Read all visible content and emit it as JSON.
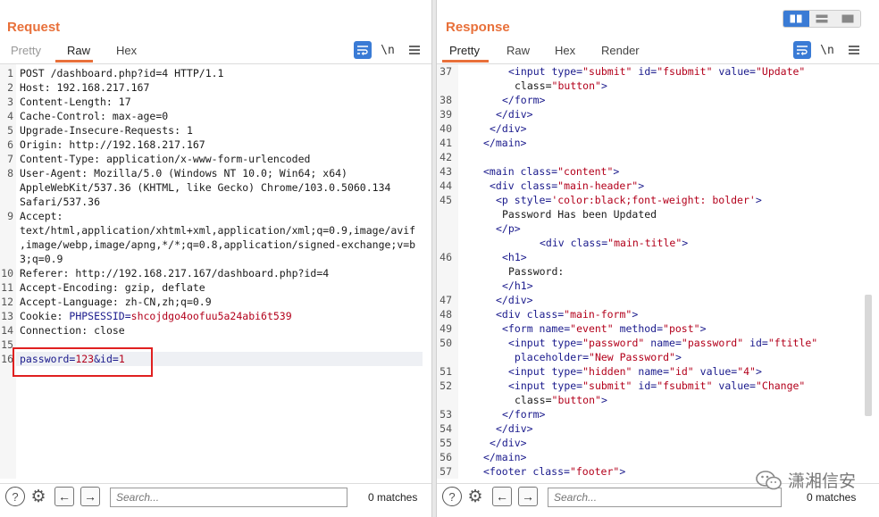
{
  "request": {
    "title": "Request",
    "tabs": [
      "Pretty",
      "Raw",
      "Hex"
    ],
    "active_tab": "Raw",
    "icons": [
      "wrap-icon",
      "newline-icon",
      "menu-icon"
    ],
    "newline_label": "\\n",
    "lines": [
      {
        "n": "1",
        "text": "POST /dashboard.php?id=4 HTTP/1.1"
      },
      {
        "n": "2",
        "text": "Host: 192.168.217.167"
      },
      {
        "n": "3",
        "text": "Content-Length: 17"
      },
      {
        "n": "4",
        "text": "Cache-Control: max-age=0"
      },
      {
        "n": "5",
        "text": "Upgrade-Insecure-Requests: 1"
      },
      {
        "n": "6",
        "text": "Origin: http://192.168.217.167"
      },
      {
        "n": "7",
        "text": "Content-Type: application/x-www-form-urlencoded"
      },
      {
        "n": "8",
        "text": "User-Agent: Mozilla/5.0 (Windows NT 10.0; Win64; x64)"
      },
      {
        "n": "",
        "text": "AppleWebKit/537.36 (KHTML, like Gecko) Chrome/103.0.5060.134"
      },
      {
        "n": "",
        "text": "Safari/537.36"
      },
      {
        "n": "9",
        "text": "Accept:"
      },
      {
        "n": "",
        "text": "text/html,application/xhtml+xml,application/xml;q=0.9,image/avif"
      },
      {
        "n": "",
        "text": ",image/webp,image/apng,*/*;q=0.8,application/signed-exchange;v=b"
      },
      {
        "n": "",
        "text": "3;q=0.9"
      },
      {
        "n": "10",
        "text": "Referer: http://192.168.217.167/dashboard.php?id=4"
      },
      {
        "n": "11",
        "text": "Accept-Encoding: gzip, deflate"
      },
      {
        "n": "12",
        "text": "Accept-Language: zh-CN,zh;q=0.9"
      },
      {
        "n": "13",
        "text": "Cookie: PHPSESSID=shcojdgo4oofuu5a24abi6t539"
      },
      {
        "n": "14",
        "text": "Connection: close"
      },
      {
        "n": "15",
        "text": ""
      },
      {
        "n": "16",
        "text": "password=123&id=1"
      }
    ],
    "search_placeholder": "Search...",
    "matches": "0 matches"
  },
  "response": {
    "title": "Response",
    "tabs": [
      "Pretty",
      "Raw",
      "Hex",
      "Render"
    ],
    "active_tab": "Pretty",
    "icons": [
      "wrap-icon",
      "newline-icon",
      "menu-icon"
    ],
    "newline_label": "\\n",
    "lines": [
      {
        "n": "37",
        "indent": 6,
        "text": "<input type=\"submit\" id=\"fsubmit\" value=\"Update\""
      },
      {
        "n": "",
        "indent": 7,
        "text": "class=\"button\">"
      },
      {
        "n": "38",
        "indent": 5,
        "text": "</form>"
      },
      {
        "n": "39",
        "indent": 4,
        "text": "</div>"
      },
      {
        "n": "40",
        "indent": 3,
        "text": "</div>"
      },
      {
        "n": "41",
        "indent": 2,
        "text": "</main>"
      },
      {
        "n": "42",
        "indent": 0,
        "text": ""
      },
      {
        "n": "43",
        "indent": 2,
        "text": "<main class=\"content\">"
      },
      {
        "n": "44",
        "indent": 3,
        "text": "<div class=\"main-header\">"
      },
      {
        "n": "45",
        "indent": 4,
        "text": "<p style='color:black;font-weight: bolder'>"
      },
      {
        "n": "",
        "indent": 5,
        "text": "Password Has been Updated"
      },
      {
        "n": "",
        "indent": 4,
        "text": "</p>"
      },
      {
        "n": "",
        "indent": 11,
        "text": "<div class=\"main-title\">"
      },
      {
        "n": "46",
        "indent": 5,
        "text": "<h1>"
      },
      {
        "n": "",
        "indent": 6,
        "text": "Password:"
      },
      {
        "n": "",
        "indent": 5,
        "text": "</h1>"
      },
      {
        "n": "47",
        "indent": 4,
        "text": "</div>"
      },
      {
        "n": "48",
        "indent": 4,
        "text": "<div class=\"main-form\">"
      },
      {
        "n": "49",
        "indent": 5,
        "text": "<form name=\"event\" method=\"post\">"
      },
      {
        "n": "50",
        "indent": 6,
        "text": "<input type=\"password\" name=\"password\" id=\"ftitle\""
      },
      {
        "n": "",
        "indent": 6,
        "text": " placeholder=\"New Password\">"
      },
      {
        "n": "51",
        "indent": 6,
        "text": "<input type=\"hidden\" name=\"id\" value=\"4\">"
      },
      {
        "n": "52",
        "indent": 6,
        "text": "<input type=\"submit\" id=\"fsubmit\" value=\"Change\""
      },
      {
        "n": "",
        "indent": 7,
        "text": "class=\"button\">"
      },
      {
        "n": "53",
        "indent": 5,
        "text": "</form>"
      },
      {
        "n": "54",
        "indent": 4,
        "text": "</div>"
      },
      {
        "n": "55",
        "indent": 3,
        "text": "</div>"
      },
      {
        "n": "56",
        "indent": 2,
        "text": "</main>"
      },
      {
        "n": "57",
        "indent": 2,
        "text": "<footer class=\"footer\">"
      }
    ],
    "search_placeholder": "Search...",
    "matches": "0 matches"
  },
  "layout_toggle": [
    "split-horizontal-icon",
    "split-vertical-icon",
    "single-pane-icon"
  ],
  "watermark": {
    "text": "潇湘信安",
    "icon": "wechat-icon"
  },
  "colors": {
    "accent": "#e8703a",
    "blue": "#3a7bd5",
    "highlight_box": "#e02020"
  }
}
